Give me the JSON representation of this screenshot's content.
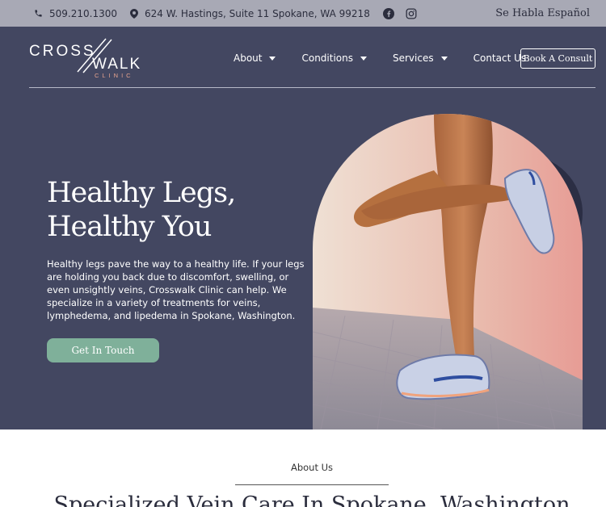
{
  "topbar": {
    "phone": "509.210.1300",
    "address": "624 W. Hastings, Suite 11 Spokane, WA 99218",
    "social": [
      "facebook-icon",
      "instagram-icon"
    ],
    "spanish": "Se Habla Español"
  },
  "logo": {
    "line1": "CROSS",
    "line2": "WALK",
    "line3": "CLINIC"
  },
  "nav": {
    "items": [
      {
        "label": "About",
        "dropdown": true
      },
      {
        "label": "Conditions",
        "dropdown": true
      },
      {
        "label": "Services",
        "dropdown": true
      },
      {
        "label": "Contact Us",
        "dropdown": false
      }
    ],
    "book_label": "Book A Consult"
  },
  "hero": {
    "title_line1": "Healthy Legs,",
    "title_line2": "Healthy You",
    "body": "Healthy legs pave the way to a healthy life. If your legs are holding you back due to discomfort, swelling, or even unsightly veins, Crosswalk Clinic can help. We specialize in a variety of treatments for veins, lymphedema, and lipedema in Spokane, Washington.",
    "cta_label": "Get In Touch"
  },
  "about": {
    "label": "About Us",
    "title": "Specialized Vein Care In Spokane, Washington"
  },
  "colors": {
    "navy": "#434761",
    "topbar": "#a8a9b5",
    "accent_green": "#7fb09a",
    "logo_peach": "#e8a48f"
  }
}
